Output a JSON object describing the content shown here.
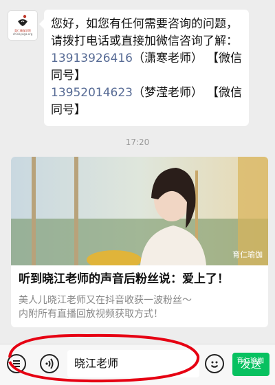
{
  "avatar": {
    "icon": "yoga-logo-icon",
    "line1": "育仁瑜伽学院",
    "line2": "chinayoga.org"
  },
  "message": {
    "line1": "您好，如您有任何需要咨询的问题，",
    "line2": "请拨打电话或直接加微信咨询了解：",
    "contact1_phone": "13913926416",
    "contact1_name": "（潇寒老师）",
    "contact1_tag": "【微信",
    "contact1_tag2": "同号】",
    "contact2_phone": "13952014623",
    "contact2_name": "（梦滢老师）",
    "contact2_tag": "【微信",
    "contact2_tag2": "同号】"
  },
  "timestamp": "17:20",
  "article": {
    "watermark": "育仁瑜伽",
    "title": "听到晓江老师的声音后粉丝说：爱上了！",
    "desc_line1": "美人儿晓江老师又在抖音收获一波粉丝～",
    "desc_line2": "内附所有直播回放视频获取方式！"
  },
  "input": {
    "value": "晓江老师",
    "send_label": "发送",
    "corner_mark": "育仁瑜伽"
  },
  "colors": {
    "send_button": "#07c160",
    "link": "#576b95",
    "annotation_circle": "#e60012"
  }
}
